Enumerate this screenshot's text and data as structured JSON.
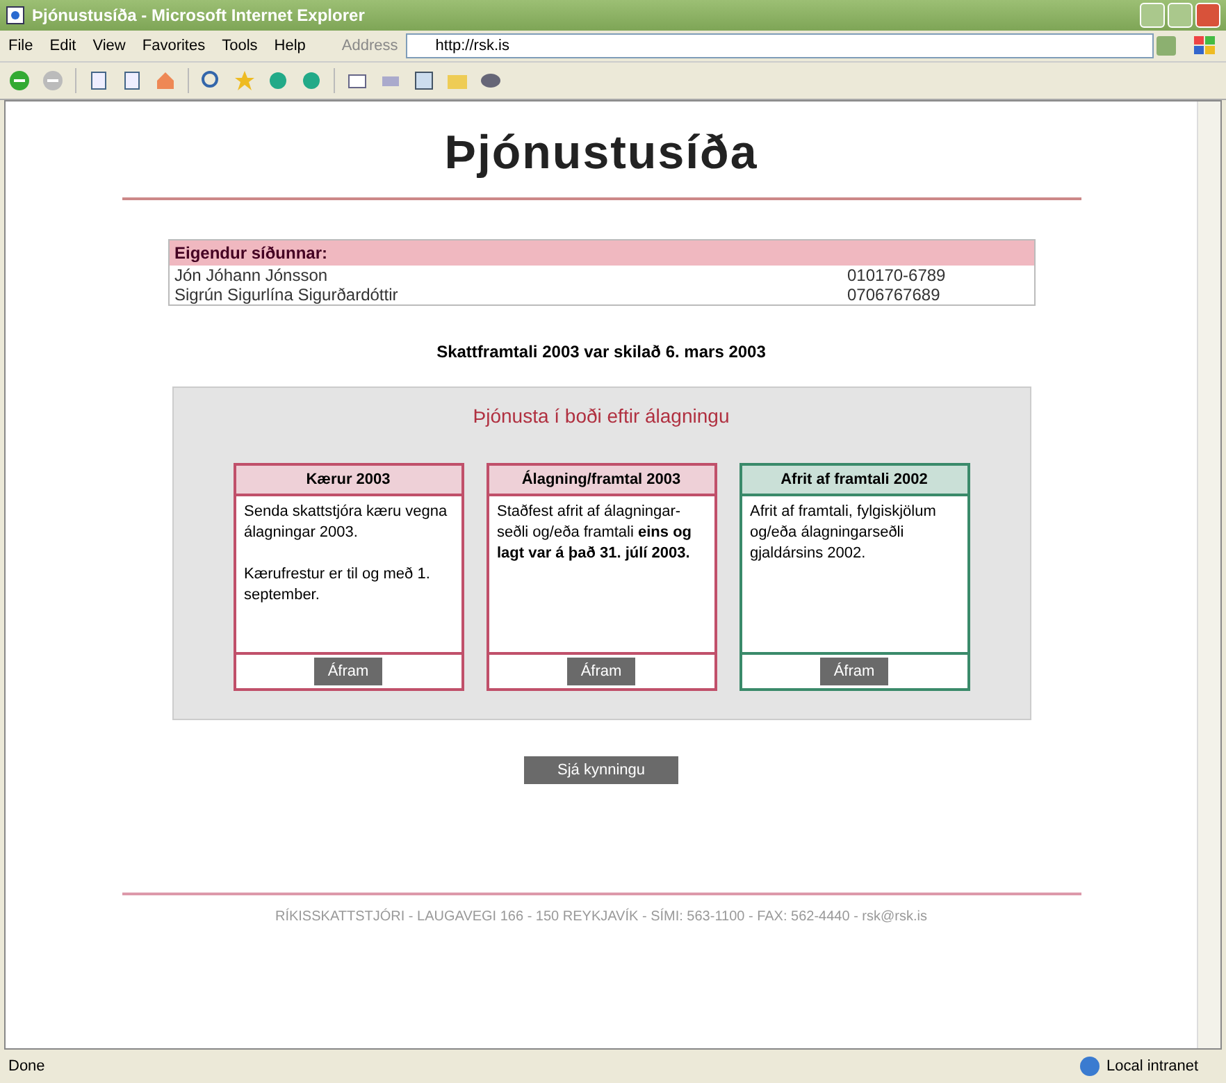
{
  "window": {
    "title": "Þjónustusíða - Microsoft Internet Explorer"
  },
  "menu": [
    "File",
    "Edit",
    "View",
    "Favorites",
    "Tools",
    "Help"
  ],
  "address": {
    "label": "Address",
    "value": "http://rsk.is"
  },
  "page": {
    "logo": "Þjónustusíða",
    "owners": {
      "heading": "Eigendur síðunnar:",
      "rows": [
        {
          "name": "Jón Jóhann Jónsson",
          "id": "010170-6789"
        },
        {
          "name": "Sigrún Sigurlína Sigurðardóttir",
          "id": "0706767689"
        }
      ]
    },
    "notice": "Skattframtali 2003 var skilað 6. mars 2003",
    "services": {
      "heading": "Þjónusta í boði eftir álagningu",
      "cards": [
        {
          "title": "Kærur 2003",
          "color": "#c0506a",
          "paragraphs": [
            "Senda skattstjóra kæru vegna álagningar 2003.",
            "Kærufrestur er til og með 1. september."
          ],
          "button": "Áfram"
        },
        {
          "title": "Álagning/framtal 2003",
          "color": "#c0506a",
          "paragraphs": [
            "Staðfest afrit af álagningar-seðli og/eða framtali **eins og lagt var á það 31. júlí 2003.**"
          ],
          "button": "Áfram"
        },
        {
          "title": "Afrit af framtali 2002",
          "color": "#3a8a6a",
          "paragraphs": [
            "Afrit af framtali, fylgiskjölum og/eða álagningarseðli gjaldársins 2002."
          ],
          "button": "Áfram"
        }
      ]
    },
    "intro_button": "Sjá kynningu",
    "footer": "RÍKISSKATTSTJÓRI - LAUGAVEGI 166 - 150 REYKJAVÍK - SÍMI: 563-1100 - FAX: 562-4440 - rsk@rsk.is"
  },
  "status_bar": {
    "text": "Done",
    "zone": "Local intranet"
  }
}
